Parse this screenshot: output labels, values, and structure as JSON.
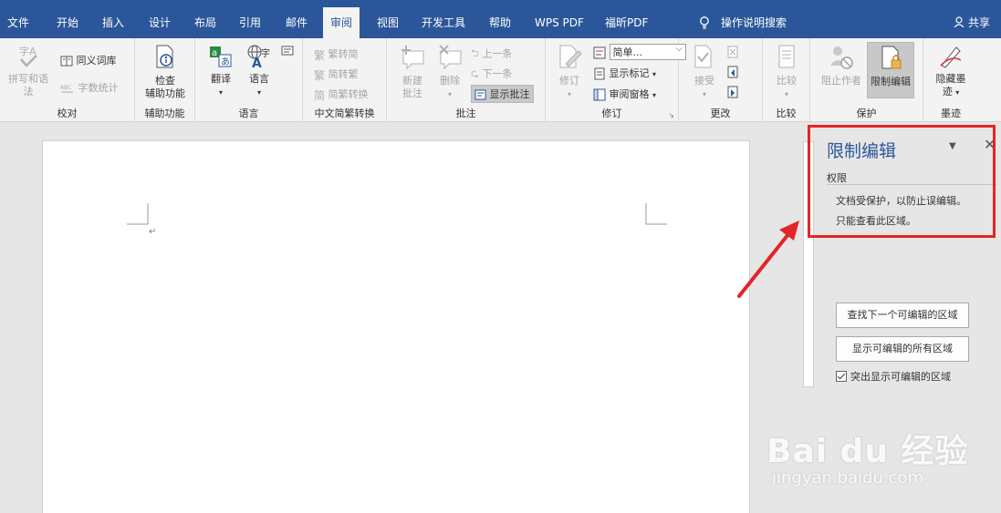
{
  "menu": {
    "tabs": [
      "文件",
      "开始",
      "插入",
      "设计",
      "布局",
      "引用",
      "邮件",
      "审阅",
      "视图",
      "开发工具",
      "帮助",
      "WPS PDF",
      "福昕PDF"
    ],
    "active_tab": "审阅",
    "search": "操作说明搜索",
    "share": "共享"
  },
  "ribbon": {
    "proofing": {
      "spelling": "拼写和语法",
      "thesaurus": "同义词库",
      "word_count": "字数统计",
      "label": "校对"
    },
    "accessibility": {
      "check_line1": "检查",
      "check_line2": "辅助功能",
      "label": "辅助功能"
    },
    "language": {
      "translate": "翻译",
      "language": "语言",
      "label": "语言"
    },
    "chinese": {
      "to_simplified": "繁转简",
      "to_traditional": "简转繁",
      "convert": "简繁转换",
      "label": "中文简繁转换"
    },
    "comments": {
      "new_line1": "新建",
      "new_line2": "批注",
      "delete": "删除",
      "previous": "上一条",
      "next": "下一条",
      "show": "显示批注",
      "label": "批注"
    },
    "tracking": {
      "track": "修订",
      "markup": "简单...",
      "show_markup": "显示标记",
      "reviewing_pane": "审阅窗格",
      "label": "修订"
    },
    "changes": {
      "accept": "接受",
      "label": "更改"
    },
    "compare": {
      "compare": "比较",
      "label": "比较"
    },
    "protect": {
      "block_authors": "阻止作者",
      "restrict_editing": "限制编辑",
      "label": "保护"
    },
    "ink": {
      "hide_line1": "隐藏墨",
      "hide_line2": "迹",
      "label": "墨迹"
    }
  },
  "pane": {
    "title": "限制编辑",
    "section": "权限",
    "message_line1": "文档受保护，以防止误编辑。",
    "message_line2": "只能查看此区域。",
    "find_next": "查找下一个可编辑的区域",
    "show_all": "显示可编辑的所有区域",
    "highlight": "突出显示可编辑的区域",
    "highlight_checked": true
  },
  "watermark": {
    "brand": "Bai du 经验",
    "url": "jingyan.baidu.com"
  },
  "colors": {
    "accent": "#2b579a",
    "annotation_red": "#e32525"
  }
}
